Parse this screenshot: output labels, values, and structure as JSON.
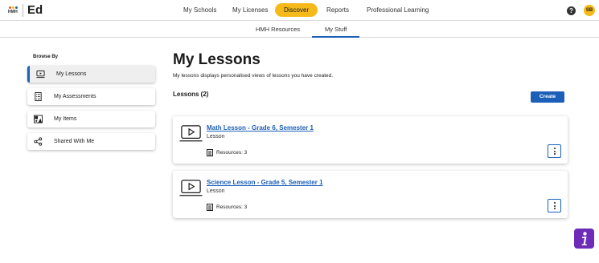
{
  "app": {
    "logo_text": "HMH",
    "product_name": "Ed",
    "logo_dot_colors": [
      "#e8552a",
      "#f5b91a",
      "#1b5fb8"
    ]
  },
  "nav": {
    "items": [
      {
        "label": "My Schools",
        "active": false
      },
      {
        "label": "My Licenses",
        "active": false
      },
      {
        "label": "Discover",
        "active": true
      },
      {
        "label": "Reports",
        "active": false
      },
      {
        "label": "Professional Learning",
        "active": false
      }
    ],
    "help_icon": "help-icon",
    "help_glyph": "?",
    "avatar_initials": "SB"
  },
  "subnav": {
    "tabs": [
      {
        "label": "HMH Resources",
        "active": false
      },
      {
        "label": "My Stuff",
        "active": true
      }
    ]
  },
  "sidebar": {
    "heading": "Browse By",
    "items": [
      {
        "label": "My Lessons",
        "icon": "lesson-icon",
        "active": true
      },
      {
        "label": "My Assessments",
        "icon": "assessment-icon",
        "active": false
      },
      {
        "label": "My Items",
        "icon": "items-icon",
        "active": false
      },
      {
        "label": "Shared With Me",
        "icon": "share-icon",
        "active": false
      }
    ]
  },
  "main": {
    "title": "My Lessons",
    "description": "My lessons displays personalised views of lessons you have created.",
    "count_label": "Lessons (2)",
    "create_label": "Create",
    "lessons": [
      {
        "title": "Math Lesson - Grade 6, Semester 1",
        "type": "Lesson",
        "resources": "Resources: 3"
      },
      {
        "title": "Science Lesson - Grade 5, Semester 1",
        "type": "Lesson",
        "resources": "Resources: 3"
      }
    ]
  },
  "colors": {
    "accent_blue": "#1b5fb8",
    "discover_yellow": "#f5b91a",
    "info_purple": "#6e2bb8"
  }
}
